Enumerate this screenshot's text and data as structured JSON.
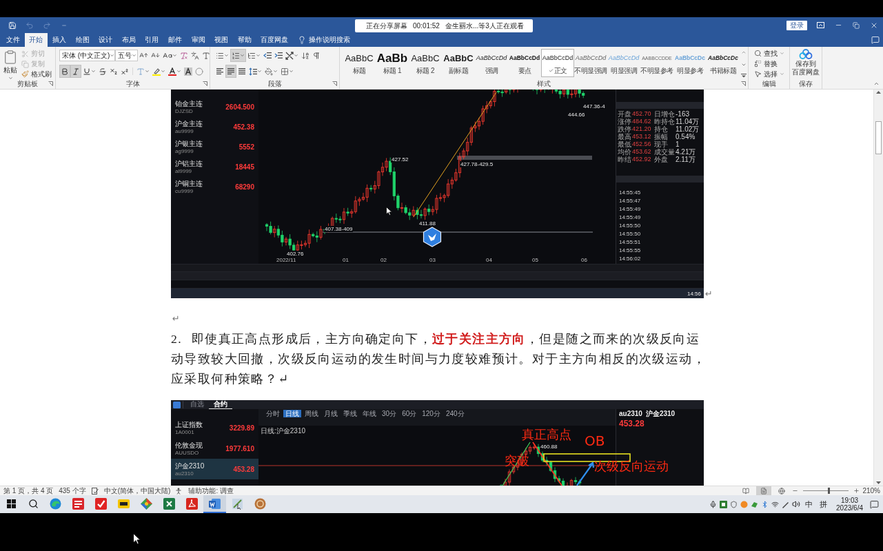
{
  "share_banner": {
    "status": "正在分享屏幕",
    "elapsed": "00:01:52",
    "viewers": "金生丽水...等3人正在观看"
  },
  "title_bar": {
    "sign_in": "登录"
  },
  "ribbon_tabs": [
    {
      "label": "文件",
      "selected": false
    },
    {
      "label": "开始",
      "selected": true
    },
    {
      "label": "插入",
      "selected": false
    },
    {
      "label": "绘图",
      "selected": false
    },
    {
      "label": "设计",
      "selected": false
    },
    {
      "label": "布局",
      "selected": false
    },
    {
      "label": "引用",
      "selected": false
    },
    {
      "label": "邮件",
      "selected": false
    },
    {
      "label": "审阅",
      "selected": false
    },
    {
      "label": "视图",
      "selected": false
    },
    {
      "label": "帮助",
      "selected": false
    },
    {
      "label": "百度网盘",
      "selected": false
    }
  ],
  "tell_me": "操作说明搜索",
  "clipboard": {
    "title": "剪贴板",
    "paste": "粘贴",
    "commands": [
      {
        "kind": "cut",
        "label": "剪切",
        "disabled": true
      },
      {
        "kind": "copy",
        "label": "复制",
        "disabled": true
      },
      {
        "kind": "painter",
        "label": "格式刷",
        "disabled": false
      }
    ]
  },
  "font": {
    "title": "字体",
    "font_name": "宋体 (中文正文)",
    "font_size": "五号",
    "format_buttons": [
      {
        "kind": "bold",
        "on": true
      },
      {
        "kind": "italic",
        "on": true
      },
      {
        "kind": "underline",
        "on": false
      },
      {
        "kind": "strike",
        "on": false
      },
      {
        "kind": "subscript",
        "on": false
      },
      {
        "kind": "superscript",
        "on": false
      }
    ]
  },
  "paragraph": {
    "title": "段落",
    "list_buttons": [
      {
        "kind": "bullets",
        "on": false
      },
      {
        "kind": "numbering",
        "on": true
      },
      {
        "kind": "multilevel",
        "on": false
      }
    ],
    "align_buttons": [
      {
        "kind": "left",
        "on": false
      },
      {
        "kind": "justify",
        "on": true
      },
      {
        "kind": "distributed",
        "on": false
      }
    ]
  },
  "styles": {
    "title": "样式",
    "items": [
      {
        "kind": "title",
        "sample": "AaBbC",
        "name": "标题",
        "selected": false
      },
      {
        "kind": "heading1",
        "sample": "AaBb",
        "name": "标题 1",
        "selected": false
      },
      {
        "kind": "heading2",
        "sample": "AaBbC",
        "name": "标题 2",
        "selected": false
      },
      {
        "kind": "subtitle",
        "sample": "AaBbC",
        "name": "副标题",
        "selected": false
      },
      {
        "kind": "emphasis",
        "sample": "AaBbCcDd",
        "name": "强调",
        "selected": false
      },
      {
        "kind": "strong",
        "sample": "AaBbCcDd",
        "name": "要点",
        "selected": false
      },
      {
        "kind": "normal",
        "sample": "AaBbCcDd",
        "name": "正文",
        "selected": true
      },
      {
        "kind": "subtle_emphasis",
        "sample": "AaBbCcDd",
        "name": "不明显强调",
        "selected": false
      },
      {
        "kind": "intense_emphasis",
        "sample": "AaBbCcDd",
        "name": "明显强调",
        "selected": false
      },
      {
        "kind": "subtle_reference",
        "sample": "AABBCCDDE",
        "name": "不明显参考",
        "selected": false
      },
      {
        "kind": "intense_reference",
        "sample": "AaBbCcDc",
        "name": "明显参考",
        "selected": false
      },
      {
        "kind": "book_title",
        "sample": "AaBbCcDc",
        "name": "书籍标题",
        "selected": false
      }
    ]
  },
  "editing": {
    "title": "编辑",
    "commands": [
      {
        "kind": "find",
        "label": "查找"
      },
      {
        "kind": "replace",
        "label": "替换"
      },
      {
        "kind": "select",
        "label": "选择"
      }
    ]
  },
  "save": {
    "title": "保存",
    "label_lines": [
      "保存到",
      "百度网盘"
    ]
  },
  "document": {
    "figure_1": {
      "watchlist": [
        {
          "name": "铂金主连",
          "code": "DJZSD",
          "price": "2604.500"
        },
        {
          "name": "沪金主连",
          "code": "au9999",
          "price": "452.38"
        },
        {
          "name": "沪银主连",
          "code": "ag9999",
          "price": "5552"
        },
        {
          "name": "沪铝主连",
          "code": "al9999",
          "price": "18445"
        },
        {
          "name": "沪铜主连",
          "code": "cu9999",
          "price": "68290"
        }
      ],
      "price_marks": [
        "427.52",
        "411.88",
        "402.76",
        "407.38-409",
        "427.78-429.5",
        "447.36-4",
        "444.66"
      ],
      "date_axis": [
        "2022/11",
        "01",
        "02",
        "03",
        "04",
        "05",
        "06"
      ],
      "quote_stats": [
        {
          "label": "开盘",
          "value": "452.70",
          "label_2": "日增仓",
          "value_2": "-163"
        },
        {
          "label": "涨停",
          "value": "484.62",
          "label_2": "昨持仓",
          "value_2": "11.04万"
        },
        {
          "label": "跌停",
          "value": "421.20",
          "label_2": "持仓",
          "value_2": "11.02万"
        },
        {
          "label": "最高",
          "value": "453.12",
          "label_2": "振幅",
          "value_2": "0.54%"
        },
        {
          "label": "最低",
          "value": "452.56",
          "label_2": "现手",
          "value_2": "1"
        },
        {
          "label": "均价",
          "value": "453.62",
          "label_2": "成交量",
          "value_2": "4.21万"
        },
        {
          "label": "昨结",
          "value": "452.92",
          "label_2": "外盘",
          "value_2": "2.11万"
        }
      ],
      "tick_times": [
        "14:55:45",
        "14:55:47",
        "14:55:49",
        "14:55:49",
        "14:55:50",
        "14:55:50",
        "14:55:51",
        "14:55:55",
        "14:56:02"
      ],
      "clock": "14:56"
    },
    "figure_1_mark": "↵",
    "blank_mark": "↵",
    "question": "2. 即使真正高点形成后，主方向确定向下，**过于关注主方向**，但是随之而来的次级反向运动导致较大回撤，次级反向运动的发生时间与力度较难预计。对于主方向相反的次级运动，应采取何种策略？↵",
    "figure_2": {
      "nav_tabs": [
        {
          "label": "自选",
          "selected": false
        },
        {
          "label": "合约",
          "selected": true
        }
      ],
      "period_tabs": [
        {
          "label": "分时",
          "selected": false
        },
        {
          "label": "日线",
          "selected": true
        },
        {
          "label": "周线",
          "selected": false
        },
        {
          "label": "月线",
          "selected": false
        },
        {
          "label": "季线",
          "selected": false
        },
        {
          "label": "年线",
          "selected": false
        },
        {
          "label": "30分",
          "selected": false
        },
        {
          "label": "60分",
          "selected": false
        },
        {
          "label": "120分",
          "selected": false
        },
        {
          "label": "240分",
          "selected": false
        }
      ],
      "watchlist": [
        {
          "name": "上证指数",
          "code": "1A0001",
          "price": "3229.89",
          "selected": false
        },
        {
          "name": "伦敦金现",
          "code": "AUUSDO",
          "price": "1977.610",
          "selected": false
        },
        {
          "name": "沪金2310",
          "code": "au2310",
          "price": "453.28",
          "selected": true
        }
      ],
      "chart_title": "日线:沪金2310",
      "peak_mark": "460.88",
      "annotations": [
        "真正高点",
        "OB",
        "突破",
        "次级反向运动"
      ],
      "symbol_code": "au2310",
      "symbol_name": "沪金2310",
      "last_price": "453.28"
    }
  },
  "status_bar": {
    "page": "第 1 页，共 4 页",
    "words": "435 个字",
    "language": "中文(简体，中国大陆)",
    "accessibility": "辅助功能: 调查",
    "views": [
      {
        "kind": "read",
        "selected": false
      },
      {
        "kind": "print",
        "selected": true
      },
      {
        "kind": "web",
        "selected": false
      }
    ],
    "zoom": {
      "level": 0.55,
      "reading": "210%"
    }
  },
  "taskbar": {
    "apps": [
      {
        "kind": "browser",
        "active": false
      },
      {
        "kind": "quotes",
        "active": false
      },
      {
        "kind": "check",
        "active": false
      },
      {
        "kind": "tile",
        "active": false
      },
      {
        "kind": "diamond",
        "active": false
      },
      {
        "kind": "sheet",
        "active": false
      },
      {
        "kind": "pdf",
        "active": false
      },
      {
        "kind": "word",
        "active": true
      },
      {
        "kind": "tool",
        "active": false
      },
      {
        "kind": "round",
        "active": false
      }
    ],
    "ime": "中",
    "ime_mode": "拼",
    "time": "19:03",
    "date": "2023/6/4"
  }
}
